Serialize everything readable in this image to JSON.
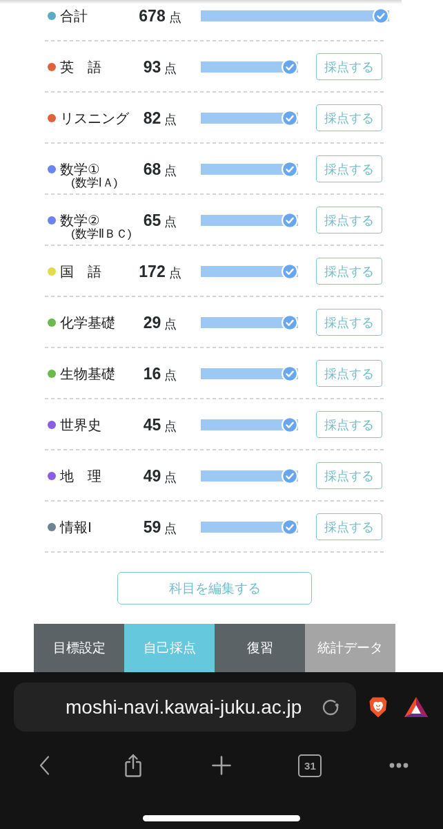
{
  "subjects": [
    {
      "kind": "total",
      "name": "合計",
      "color": "#5aacc4",
      "score": "678",
      "unit": "点",
      "level": 1,
      "completed": true
    },
    {
      "kind": "subject",
      "name": "英　語",
      "color": "#e0623a",
      "score": "93",
      "unit": "点",
      "level": 1,
      "completed": true,
      "button": "採点する"
    },
    {
      "kind": "subject",
      "name": "リスニング",
      "color": "#e0623a",
      "score": "82",
      "unit": "点",
      "level": 1,
      "completed": true,
      "button": "採点する"
    },
    {
      "kind": "subject",
      "name": "数学①",
      "note": "(数学ⅠＡ)",
      "color": "#6a86ee",
      "score": "68",
      "unit": "点",
      "level": 1,
      "completed": true,
      "button": "採点する"
    },
    {
      "kind": "subject",
      "name": "数学②",
      "note": "(数学ⅡＢＣ)",
      "color": "#6a86ee",
      "score": "65",
      "unit": "点",
      "level": 1,
      "completed": true,
      "button": "採点する"
    },
    {
      "kind": "subject",
      "name": "国　語",
      "color": "#e2dc4c",
      "score": "172",
      "unit": "点",
      "level": 1,
      "completed": true,
      "button": "採点する"
    },
    {
      "kind": "subject",
      "name": "化学基礎",
      "color": "#6cb94c",
      "score": "29",
      "unit": "点",
      "level": 1,
      "completed": true,
      "button": "採点する"
    },
    {
      "kind": "subject",
      "name": "生物基礎",
      "color": "#6cb94c",
      "score": "16",
      "unit": "点",
      "level": 1,
      "completed": true,
      "button": "採点する"
    },
    {
      "kind": "subject",
      "name": "世界史",
      "color": "#8b5ce6",
      "score": "45",
      "unit": "点",
      "level": 1,
      "completed": true,
      "button": "採点する"
    },
    {
      "kind": "subject",
      "name": "地　理",
      "color": "#8b5ce6",
      "score": "49",
      "unit": "点",
      "level": 1,
      "completed": true,
      "button": "採点する"
    },
    {
      "kind": "subject",
      "name": "情報Ⅰ",
      "color": "#6a8492",
      "score": "59",
      "unit": "点",
      "level": 1,
      "completed": true,
      "button": "採点する"
    }
  ],
  "edit_button": "科目を編集する",
  "tabs": [
    {
      "label": "目標設定",
      "selected": false,
      "disabled": false
    },
    {
      "label": "自己採点",
      "selected": true,
      "disabled": false
    },
    {
      "label": "復習",
      "selected": false,
      "disabled": false
    },
    {
      "label": "統計データ",
      "selected": false,
      "disabled": true
    }
  ],
  "browser": {
    "url": "moshi-navi.kawai-juku.ac.jp",
    "tab_count": "31"
  }
}
